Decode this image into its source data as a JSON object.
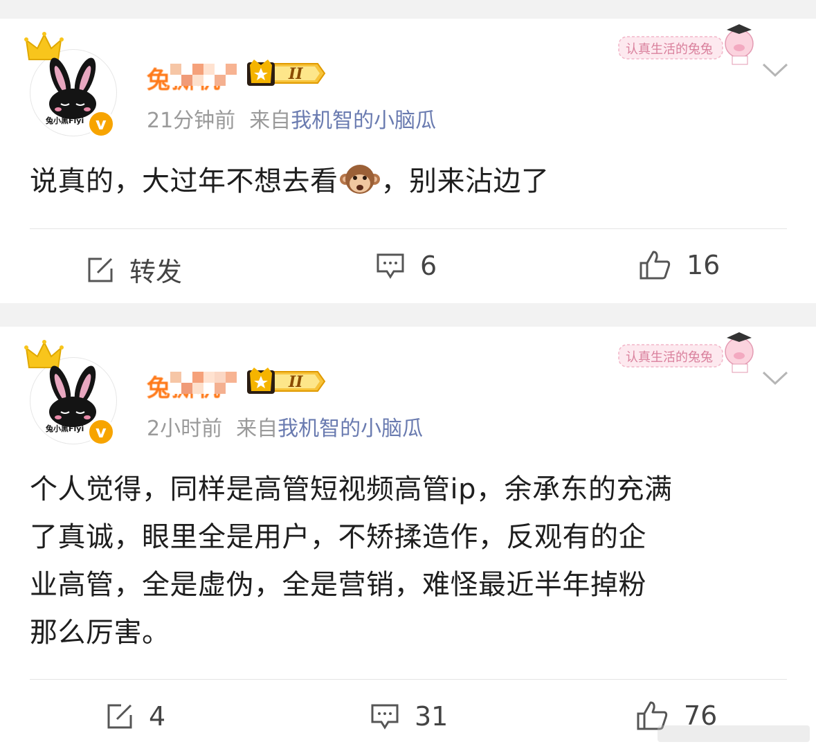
{
  "posts": [
    {
      "avatar_text": "兔小黑Flyi",
      "username": "兔撕机",
      "level": "II",
      "time": "21分钟前",
      "source_prefix": "来自",
      "source": "我机智的小脑瓜",
      "sticker_text": "认真生活的兔兔",
      "content_before": "说真的，大过年不想去看",
      "content_emoji": "monkey-face",
      "content_after": "，别来沾边了",
      "actions": {
        "repost": "转发",
        "comments": "6",
        "likes": "16"
      }
    },
    {
      "avatar_text": "兔小黑Flyi",
      "username": "兔撕机",
      "level": "II",
      "time": "2小时前",
      "source_prefix": "来自",
      "source": "我机智的小脑瓜",
      "sticker_text": "认真生活的兔兔",
      "content_lines": [
        "个人觉得，同样是高管短视频高管ip，余承东的充满",
        "了真诚，眼里全是用户，不矫揉造作，反观有的企",
        "业高管，全是虚伪，全是营销，难怪最近半年掉粉",
        "那么厉害。"
      ],
      "actions": {
        "repost": "4",
        "comments": "31",
        "likes": "76"
      }
    }
  ],
  "colors": {
    "username": "#ff7a1a",
    "source_link": "#6a7bb0",
    "meta": "#9a9a9a",
    "verified": "#f7a400",
    "crown": "#f8c51c"
  }
}
